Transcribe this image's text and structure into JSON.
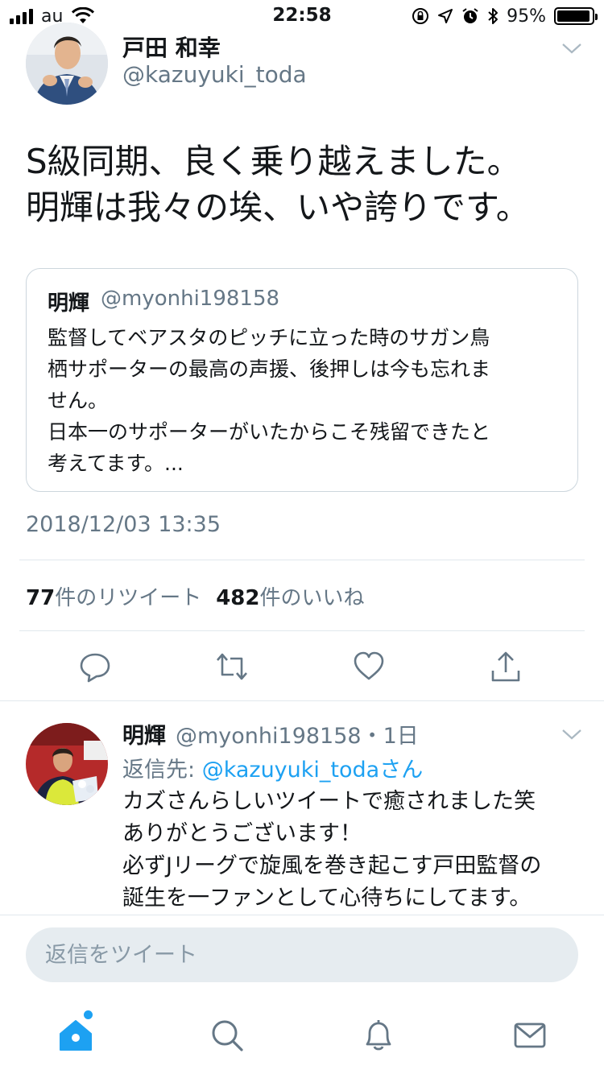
{
  "status_bar": {
    "carrier": "au",
    "time": "22:58",
    "battery": "95%",
    "battery_level": 0.95,
    "icons": [
      "signal-icon",
      "wifi-icon",
      "orientation-lock-icon",
      "location-icon",
      "alarm-icon",
      "bluetooth-icon",
      "battery-icon"
    ]
  },
  "tweet": {
    "author_name": "戸田 和幸",
    "author_handle": "@kazuyuki_toda",
    "text_lines": [
      "S級同期、良く乗り越えました。",
      "明輝は我々の埃、いや誇りです。"
    ],
    "quote": {
      "name": "明輝",
      "handle": "@myonhi198158",
      "lines": [
        "監督してベアスタのピッチに立った時のサガン鳥",
        "栖サポーターの最高の声援、後押しは今も忘れま",
        "せん。",
        "日本一のサポーターがいたからこそ残留できたと",
        "考えてます。..."
      ]
    },
    "timestamp": "2018/12/03 13:35",
    "retweet_count": "77",
    "retweet_label": "件のリツイート",
    "like_count": "482",
    "like_label": "件のいいね",
    "actions": [
      "reply-icon",
      "retweet-icon",
      "like-icon",
      "share-icon"
    ]
  },
  "reply": {
    "name": "明輝",
    "handle_meta": "@myonhi198158・1日",
    "reply_to_prefix": "返信先: ",
    "reply_to_handle": "@kazuyuki_toda",
    "reply_to_suffix": "さん",
    "lines": [
      "カズさんらしいツイートで癒されました笑",
      "ありがとうございます！",
      "必ずJリーグで旋風を巻き起こす戸田監督の",
      "誕生を一ファンとして心待ちにしてます。"
    ]
  },
  "compose": {
    "placeholder": "返信をツイート"
  },
  "tab_bar": {
    "tabs": [
      "home-icon",
      "search-icon",
      "notifications-icon",
      "messages-icon"
    ],
    "active": "home-icon",
    "accent": "#1da1f2"
  },
  "colors": {
    "text": "#14171a",
    "secondary": "#657786",
    "link": "#1da1f2",
    "border": "#e1e8ed"
  }
}
